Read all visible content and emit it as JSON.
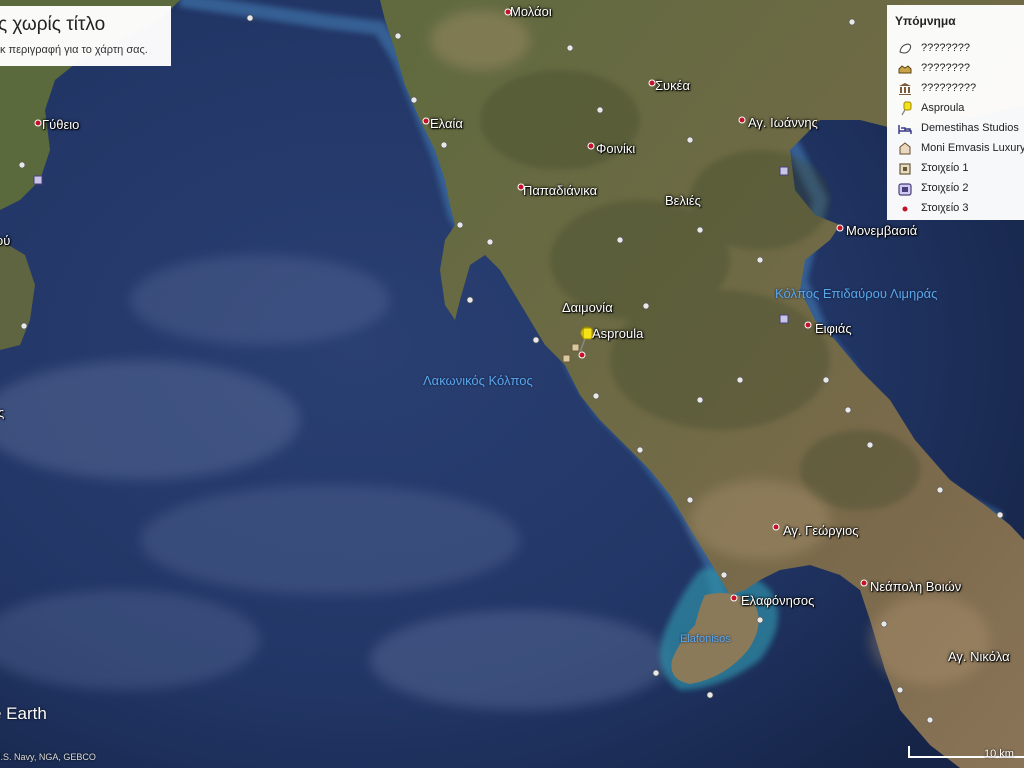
{
  "header": {
    "title": "ς χωρίς τίτλο",
    "description": "κ περιγραφή για το χάρτη σας."
  },
  "legend": {
    "title": "Υπόμνημα",
    "items": [
      {
        "label": "????????",
        "icon": "polygon-icon"
      },
      {
        "label": "????????",
        "icon": "restaurant-icon"
      },
      {
        "label": "?????????",
        "icon": "museum-icon"
      },
      {
        "label": "Asproula",
        "icon": "yellow-pushpin-icon"
      },
      {
        "label": "Demestihas Studios",
        "icon": "hotel-bed-icon"
      },
      {
        "label": "Moni Emvasis Luxury",
        "icon": "lodging-icon"
      },
      {
        "label": "Στοιχείο 1",
        "icon": "square-marker-icon"
      },
      {
        "label": "Στοιχείο 2",
        "icon": "building-marker-icon"
      },
      {
        "label": "Στοιχείο 3",
        "icon": "red-dot-icon"
      }
    ]
  },
  "places": [
    {
      "name": "Μολάοι"
    },
    {
      "name": "Γύθειο"
    },
    {
      "name": "Συκέα"
    },
    {
      "name": "Αγ. Ιωάννης"
    },
    {
      "name": "Ελαία"
    },
    {
      "name": "Φοινίκι"
    },
    {
      "name": "Παπαδιάνικα"
    },
    {
      "name": "Βελιές"
    },
    {
      "name": "Μονεμβασιά"
    },
    {
      "name": "Δαιμονία"
    },
    {
      "name": "Asproula"
    },
    {
      "name": "Ειφιάς"
    },
    {
      "name": "Αγ. Γεώργιος"
    },
    {
      "name": "Νεάπολη Βοιών"
    },
    {
      "name": "Ελαφόνησος"
    },
    {
      "name": "Αγ. Νικόλα"
    },
    {
      "name": "ού"
    },
    {
      "name": "ς"
    }
  ],
  "water": [
    {
      "name": "Κόλπος Επιδαύρου Λιμηράς"
    },
    {
      "name": "Λακωνικός Κόλπος"
    },
    {
      "name": "Elafonisos"
    }
  ],
  "branding": "e Earth",
  "attribution": "U.S. Navy, NGA, GEBCO",
  "scale_label": "10 km",
  "colors": {
    "sea": "#1e2f5a",
    "land": "#6e6a45",
    "land_dry": "#8a7458",
    "shallow": "#3fb8c8",
    "water_label": "#5aa6ea",
    "pin": "#f4e21a"
  }
}
